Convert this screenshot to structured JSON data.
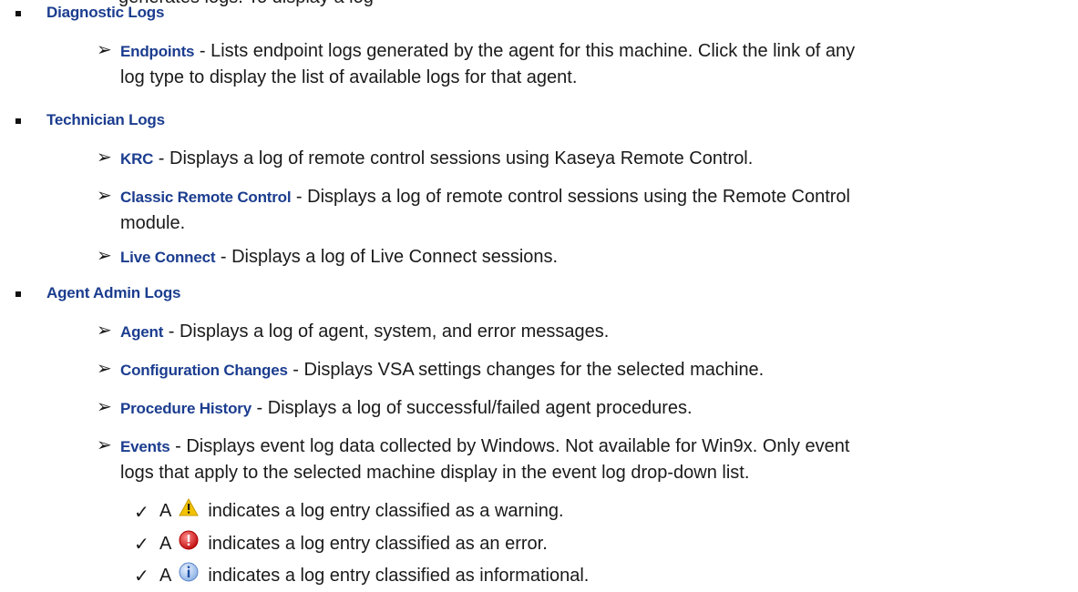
{
  "top_partial": "generates logs. To display a log",
  "sections": [
    {
      "title": "Diagnostic Logs",
      "items": [
        {
          "label": "Endpoints",
          "text_line1": " - Lists endpoint logs generated by the agent for this machine. Click the link of any",
          "text_line2": "log type to display the list of available logs for that agent."
        }
      ]
    },
    {
      "title": "Technician Logs",
      "items": [
        {
          "label": "KRC",
          "text_line1": " - Displays a log of remote control sessions using Kaseya Remote Control."
        },
        {
          "label": "Classic Remote Control",
          "text_line1": " - Displays a log of remote control sessions using the Remote Control",
          "text_line2": "module."
        },
        {
          "label": "Live Connect",
          "text_line1": " - Displays a log of Live Connect sessions."
        }
      ]
    },
    {
      "title": "Agent Admin Logs",
      "items": [
        {
          "label": "Agent",
          "text_line1": " - Displays a log of agent, system, and error messages."
        },
        {
          "label": "Configuration Changes",
          "text_line1": " - Displays VSA settings changes for the selected machine."
        },
        {
          "label": "Procedure History",
          "text_line1": " - Displays a log of successful/failed agent procedures."
        },
        {
          "label": "Events",
          "text_line1": " - Displays event log data collected by Windows. Not available for Win9x. Only event",
          "text_line2": "logs that apply to the selected machine display in the event log drop-down list."
        }
      ]
    }
  ],
  "icon_notes": [
    {
      "prefix": "A",
      "icon": "warning-icon",
      "text": "indicates a log entry classified as a warning."
    },
    {
      "prefix": "A",
      "icon": "error-icon",
      "text": "indicates a log entry classified as an error."
    },
    {
      "prefix": "A",
      "icon": "info-icon",
      "text": "indicates a log entry classified as informational."
    }
  ],
  "colors": {
    "label_blue": "#1b3d8f",
    "body_text": "#1a1a1a"
  }
}
